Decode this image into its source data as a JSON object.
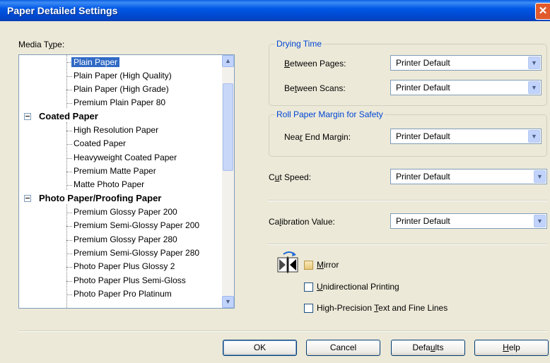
{
  "window": {
    "title": "Paper Detailed Settings",
    "close_glyph": "✕"
  },
  "media_type": {
    "label_prefix": "Media T",
    "label_mnemonic": "y",
    "label_suffix": "pe:",
    "items": [
      {
        "label": "Plain Paper",
        "selected": true
      },
      {
        "label": "Plain Paper (High Quality)"
      },
      {
        "label": "Plain Paper (High Grade)"
      },
      {
        "label": "Premium Plain Paper 80"
      },
      {
        "label": "Coated Paper",
        "category": true
      },
      {
        "label": "High Resolution Paper"
      },
      {
        "label": "Coated Paper"
      },
      {
        "label": "Heavyweight Coated Paper"
      },
      {
        "label": "Premium Matte Paper"
      },
      {
        "label": "Matte Photo Paper"
      },
      {
        "label": "Photo Paper/Proofing Paper",
        "category": true
      },
      {
        "label": "Premium Glossy Paper 200"
      },
      {
        "label": "Premium Semi-Glossy Paper 200"
      },
      {
        "label": "Premium Glossy Paper 280"
      },
      {
        "label": "Premium Semi-Glossy Paper 280"
      },
      {
        "label": "Photo Paper Plus Glossy 2"
      },
      {
        "label": "Photo Paper Plus Semi-Gloss"
      },
      {
        "label": "Photo Paper Pro Platinum"
      }
    ]
  },
  "drying_time": {
    "title": "Drying Time",
    "between_pages": {
      "pre": "",
      "mn": "B",
      "post": "etween Pages:",
      "value": "Printer Default"
    },
    "between_scans": {
      "pre": "Be",
      "mn": "t",
      "post": "ween Scans:",
      "value": "Printer Default"
    }
  },
  "roll_paper": {
    "title": "Roll Paper Margin for Safety",
    "near_end": {
      "pre": "Nea",
      "mn": "r",
      "post": " End Margin:",
      "value": "Printer Default"
    }
  },
  "cut_speed": {
    "pre": "C",
    "mn": "u",
    "post": "t Speed:",
    "value": "Printer Default"
  },
  "calibration": {
    "pre": "Ca",
    "mn": "l",
    "post": "ibration Value:",
    "value": "Printer Default"
  },
  "options": {
    "mirror": {
      "pre": "",
      "mn": "M",
      "post": "irror",
      "checked": false
    },
    "unidirectional": {
      "pre": "",
      "mn": "U",
      "post": "nidirectional Printing",
      "checked": false
    },
    "high_precision": {
      "pre": "High-Precision ",
      "mn": "T",
      "post": "ext and Fine Lines",
      "checked": false
    }
  },
  "buttons": {
    "ok": "OK",
    "cancel": "Cancel",
    "defaults": {
      "pre": "Defa",
      "mn": "u",
      "post": "lts"
    },
    "help": {
      "pre": "",
      "mn": "H",
      "post": "elp"
    }
  },
  "icons": {
    "dropdown": "chevron-down-icon",
    "scroll_up": "▲",
    "scroll_down": "▼",
    "dropdown_glyph": "▼"
  }
}
